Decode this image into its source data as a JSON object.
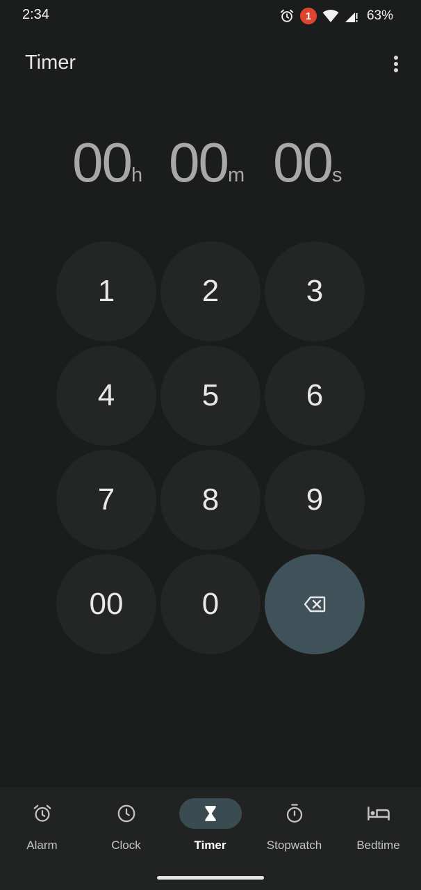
{
  "status_bar": {
    "time": "2:34",
    "notification_count": "1",
    "battery": "63%",
    "icons": [
      "alarm-icon",
      "notification-badge",
      "wifi-icon",
      "signal-icon"
    ]
  },
  "app_bar": {
    "title": "Timer",
    "menu_icon": "more-vert-icon"
  },
  "timer": {
    "hours": "00",
    "hours_unit": "h",
    "minutes": "00",
    "minutes_unit": "m",
    "seconds": "00",
    "seconds_unit": "s"
  },
  "keypad": {
    "keys": [
      "1",
      "2",
      "3",
      "4",
      "5",
      "6",
      "7",
      "8",
      "9",
      "00",
      "0"
    ],
    "backspace_icon": "backspace-icon"
  },
  "bottom_nav": {
    "items": [
      {
        "label": "Alarm",
        "icon": "alarm-icon"
      },
      {
        "label": "Clock",
        "icon": "clock-icon"
      },
      {
        "label": "Timer",
        "icon": "hourglass-icon",
        "active": true
      },
      {
        "label": "Stopwatch",
        "icon": "stopwatch-icon"
      },
      {
        "label": "Bedtime",
        "icon": "bed-icon"
      }
    ]
  },
  "colors": {
    "background": "#1b1c1c",
    "key_background": "#232625",
    "backspace_background": "#3f525a",
    "active_nav_pill": "#3a4c52",
    "notification_badge": "#e0432f",
    "timer_digits": "#a8a8a8"
  }
}
